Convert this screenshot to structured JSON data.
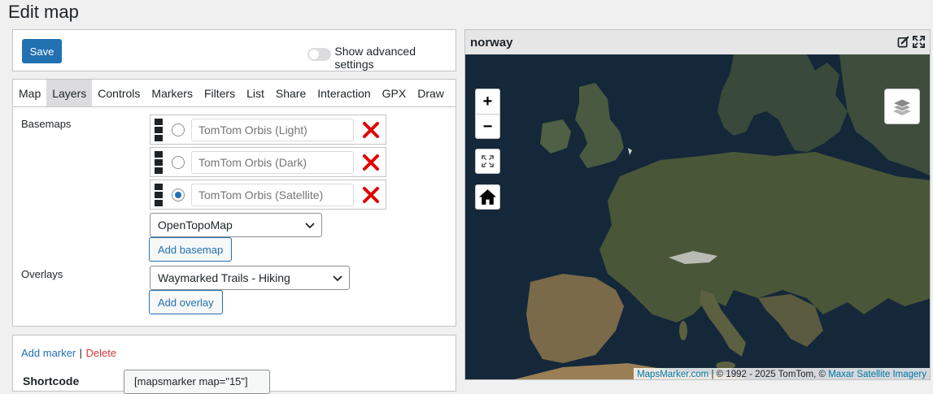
{
  "page": {
    "title": "Edit map"
  },
  "toolbar": {
    "save_label": "Save",
    "advanced_label": "Show advanced settings"
  },
  "tabs": [
    {
      "label": "Map"
    },
    {
      "label": "Layers"
    },
    {
      "label": "Controls"
    },
    {
      "label": "Markers"
    },
    {
      "label": "Filters"
    },
    {
      "label": "List"
    },
    {
      "label": "Share"
    },
    {
      "label": "Interaction"
    },
    {
      "label": "GPX"
    },
    {
      "label": "Draw"
    }
  ],
  "active_tab": "Layers",
  "layers": {
    "basemaps_label": "Basemaps",
    "basemaps": [
      {
        "placeholder": "TomTom Orbis (Light)",
        "selected": false
      },
      {
        "placeholder": "TomTom Orbis (Dark)",
        "selected": false
      },
      {
        "placeholder": "TomTom Orbis (Satellite)",
        "selected": true
      }
    ],
    "basemap_select": "OpenTopoMap",
    "add_basemap_label": "Add basemap",
    "overlays_label": "Overlays",
    "overlay_select": "Waymarked Trails - Hiking",
    "add_overlay_label": "Add overlay"
  },
  "markers": {
    "add_label": "Add marker",
    "separator": "|",
    "delete_label": "Delete",
    "shortcode_label": "Shortcode",
    "shortcode_value": "[mapsmarker map=\"15\"]"
  },
  "map": {
    "title": "norway",
    "zoom_in": "+",
    "zoom_out": "−",
    "attribution_link": "MapsMarker.com",
    "attribution_text": " | © 1992 - 2025 TomTom, © ",
    "attribution_link2": "Maxar Satellite Imagery"
  },
  "colors": {
    "primary": "#2271b1",
    "danger": "#d63638",
    "delete_x": "#e00000"
  }
}
